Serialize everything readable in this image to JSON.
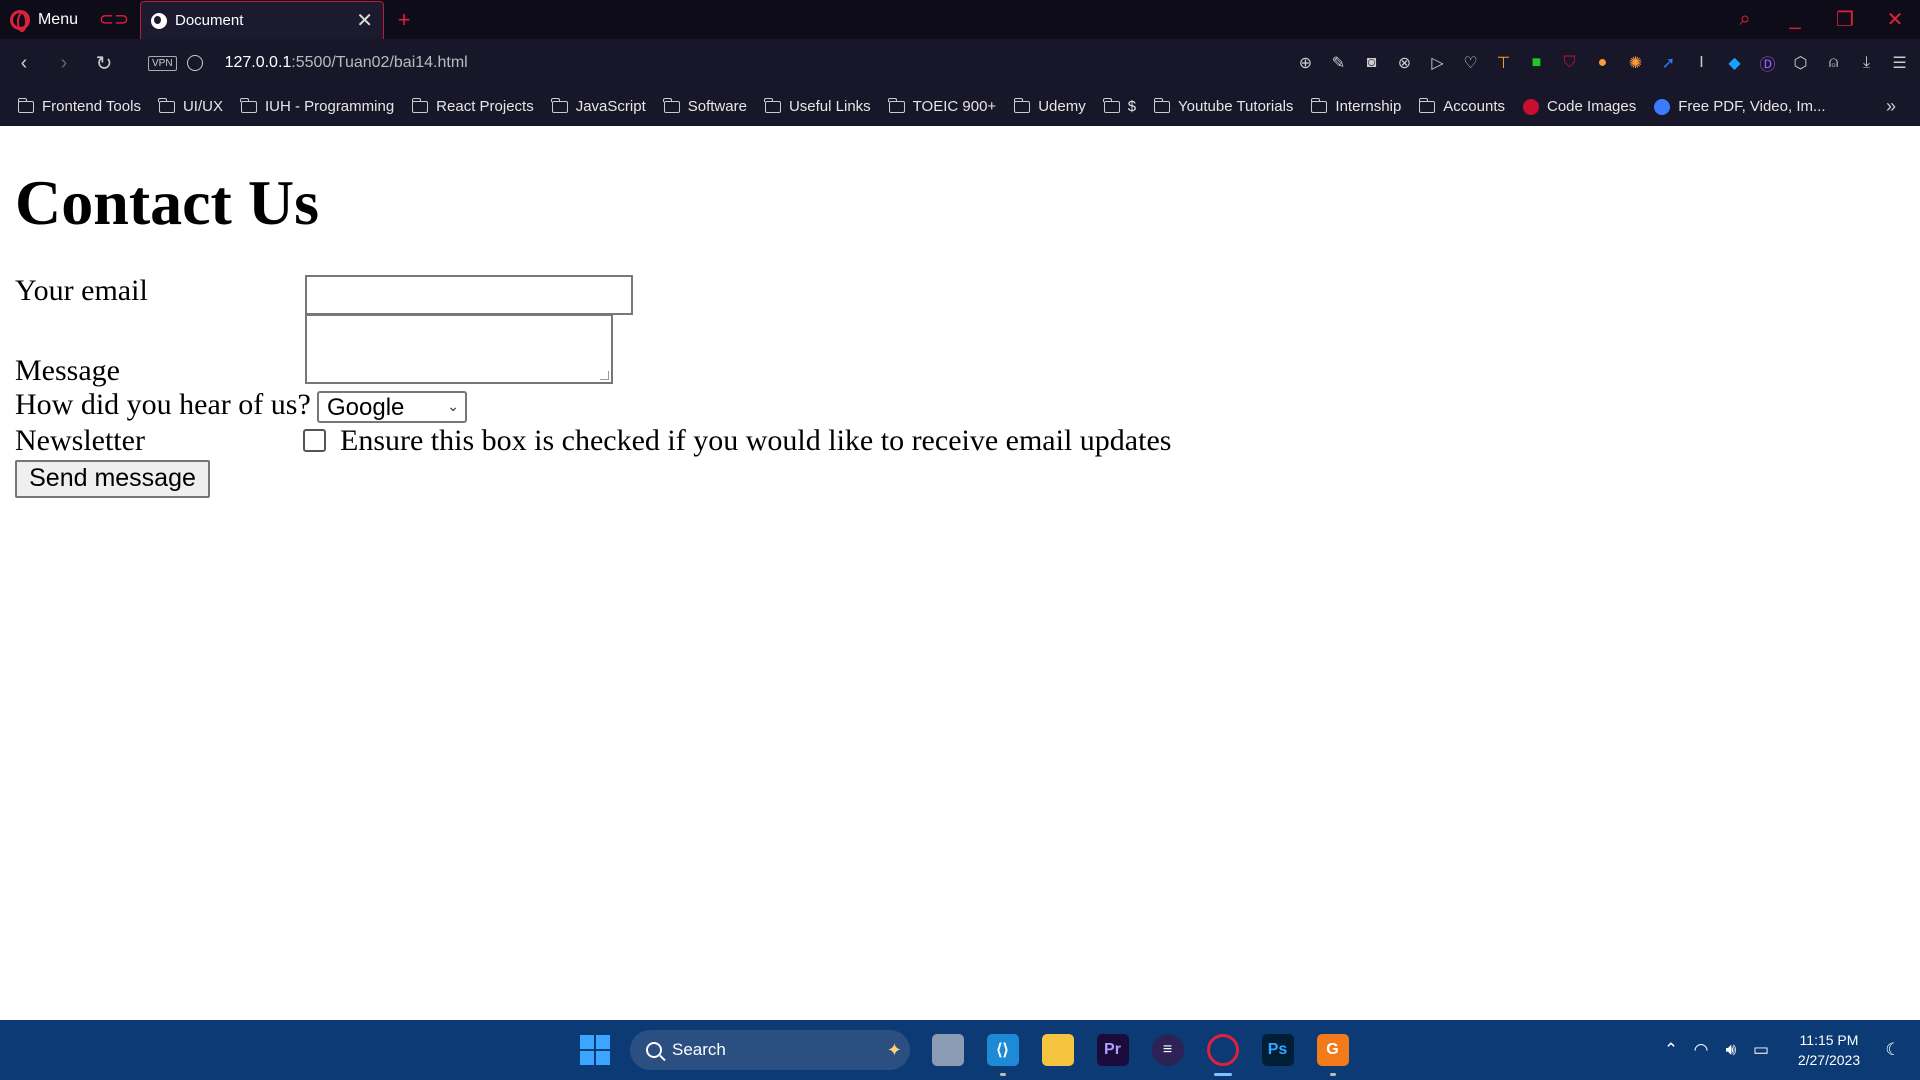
{
  "browser": {
    "menu_label": "Menu",
    "tab_title": "Document",
    "tab_close": "✕",
    "new_tab": "+",
    "url_host": "127.0.0.1",
    "url_path": ":5500/Tuan02/bai14.html",
    "vpn_label": "VPN",
    "bookmarks": [
      {
        "label": "Frontend Tools",
        "icon": "folder-icon"
      },
      {
        "label": "UI/UX",
        "icon": "folder-icon"
      },
      {
        "label": "IUH - Programming",
        "icon": "folder-icon"
      },
      {
        "label": "React Projects",
        "icon": "folder-icon"
      },
      {
        "label": "JavaScript",
        "icon": "folder-icon"
      },
      {
        "label": "Software",
        "icon": "folder-icon"
      },
      {
        "label": "Useful Links",
        "icon": "folder-icon"
      },
      {
        "label": "TOEIC 900+",
        "icon": "folder-icon"
      },
      {
        "label": "Udemy",
        "icon": "folder-icon"
      },
      {
        "label": "$",
        "icon": "folder-icon"
      },
      {
        "label": "Youtube Tutorials",
        "icon": "folder-icon"
      },
      {
        "label": "Internship",
        "icon": "folder-icon"
      },
      {
        "label": "Accounts",
        "icon": "folder-icon"
      },
      {
        "label": "Code Images",
        "icon": "code-images-icon"
      },
      {
        "label": "Free PDF, Video, Im...",
        "icon": "site-icon"
      }
    ],
    "accent_color": "#e0213c"
  },
  "page": {
    "heading": "Contact Us",
    "email_label": "Your email",
    "email_value": "",
    "message_label": "Message",
    "message_value": "",
    "hear_label": "How did you hear of us?",
    "hear_selected": "Google",
    "newsletter_label": "Newsletter",
    "newsletter_checked": false,
    "newsletter_text": "Ensure this box is checked if you would like to receive email updates",
    "send_button": "Send message"
  },
  "taskbar": {
    "search_label": "Search",
    "time": "11:15 PM",
    "date": "2/27/2023",
    "background": "#0b3a74"
  }
}
